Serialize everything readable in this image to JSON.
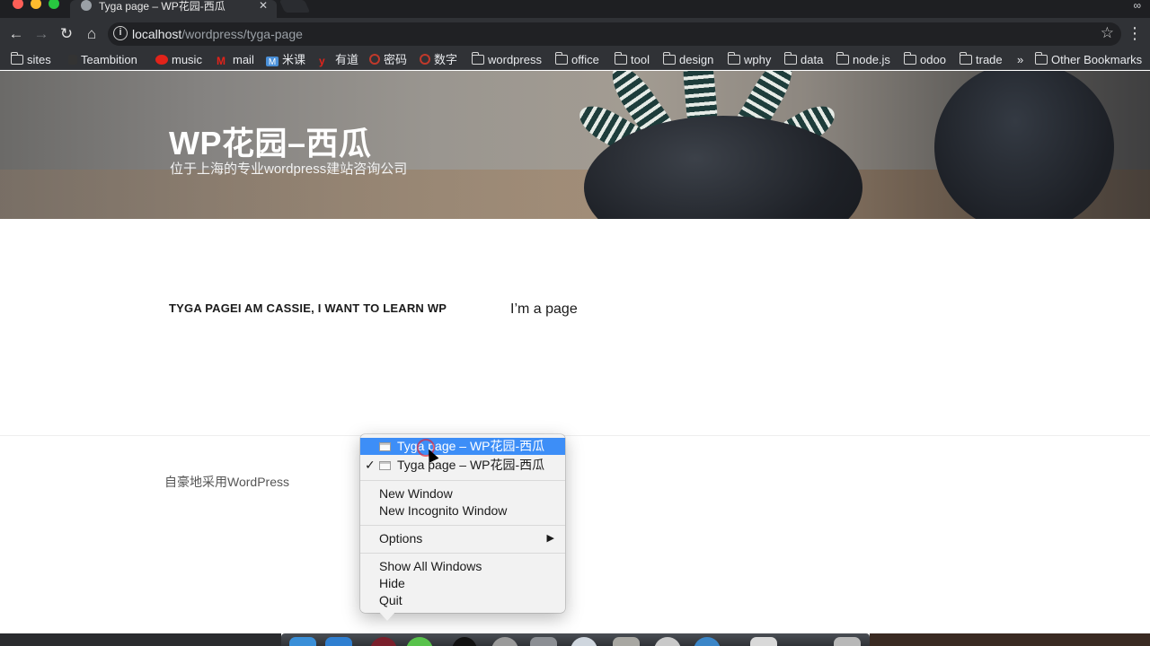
{
  "browser": {
    "tab_title": "Tyga page – WP花园-西瓜",
    "tab_close": "✕",
    "url_host": "localhost",
    "url_path": "/wordpress/tyga-page",
    "bookmarks": [
      "sites",
      "Teambition",
      "music",
      "mail",
      "米课",
      "有道",
      "密码",
      "数字",
      "wordpress",
      "office",
      "tool",
      "design",
      "wphy",
      "data",
      "node.js",
      "odoo",
      "trade"
    ],
    "overflow": "»",
    "other_bookmarks": "Other Bookmarks"
  },
  "site": {
    "title": "WP花园–西瓜",
    "description": "位于上海的专业wordpress建站咨询公司"
  },
  "post": {
    "title": "TYGA PAGEI AM CASSIE, I WANT TO LEARN WP",
    "content": "I’m a page"
  },
  "footer": {
    "credit": "自豪地采用WordPress"
  },
  "context_menu": {
    "windows": [
      "Tyga page – WP花园-西瓜",
      "Tyga page – WP花园-西瓜"
    ],
    "check": "✓",
    "new_window": "New Window",
    "new_incognito": "New Incognito Window",
    "options": "Options",
    "options_arrow": "▶",
    "show_all": "Show All Windows",
    "hide": "Hide",
    "quit": "Quit"
  }
}
